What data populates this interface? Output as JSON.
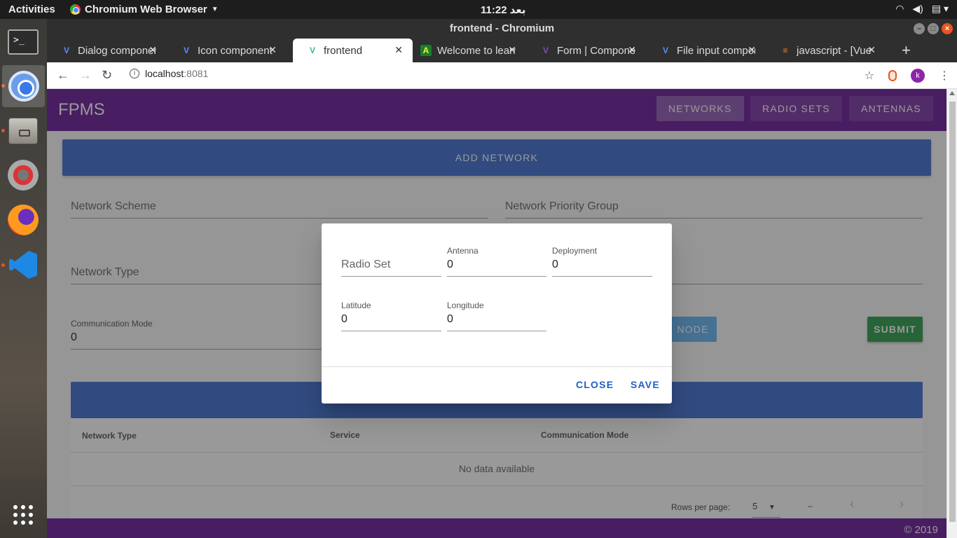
{
  "os": {
    "activities": "Activities",
    "app_menu": "Chromium Web Browser",
    "clock": "11:22 بعد",
    "tray": [
      "wifi-icon",
      "volume-icon",
      "battery-icon"
    ]
  },
  "dock": {
    "items": [
      "terminal",
      "chromium",
      "files",
      "settings",
      "firefox",
      "vscode",
      "show-apps"
    ],
    "active": "chromium"
  },
  "window": {
    "title": "frontend - Chromium"
  },
  "tabs": [
    {
      "label": "Dialog component",
      "favicon": "V",
      "active": false
    },
    {
      "label": "Icon component",
      "favicon": "V",
      "active": false
    },
    {
      "label": "frontend",
      "favicon": "V",
      "active": true
    },
    {
      "label": "Welcome to learn",
      "favicon": "A",
      "active": false
    },
    {
      "label": "Form | Component",
      "favicon": "B",
      "active": false
    },
    {
      "label": "File input component",
      "favicon": "V",
      "active": false
    },
    {
      "label": "javascript - [Vue",
      "favicon": "S",
      "active": false
    }
  ],
  "address": {
    "host": "localhost",
    "port": ":8081"
  },
  "app": {
    "brand": "FPMS",
    "nav": [
      {
        "label": "NETWORKS",
        "active": true
      },
      {
        "label": "RADIO SETS",
        "active": false
      },
      {
        "label": "ANTENNAS",
        "active": false
      }
    ],
    "add_button": "ADD NETWORK",
    "form": {
      "network_scheme": "Network Scheme",
      "network_priority_group": "Network Priority Group",
      "network_type": "Network Type",
      "communication_mode_label": "Communication Mode",
      "communication_mode_value": "0",
      "node_button": "NODE",
      "submit_button": "SUBMIT"
    },
    "table": {
      "headers": [
        "Network Type",
        "Service",
        "Communication Mode"
      ],
      "empty": "No data available",
      "rows_per_page_label": "Rows per page:",
      "rows_per_page_value": "5",
      "range": "–"
    },
    "footer": "© 2019"
  },
  "dialog": {
    "radio_set_placeholder": "Radio Set",
    "antenna_label": "Antenna",
    "antenna_value": "0",
    "deployment_label": "Deployment",
    "deployment_value": "0",
    "latitude_label": "Latitude",
    "latitude_value": "0",
    "longitude_label": "Longitude",
    "longitude_value": "0",
    "close_label": "CLOSE",
    "save_label": "SAVE"
  }
}
